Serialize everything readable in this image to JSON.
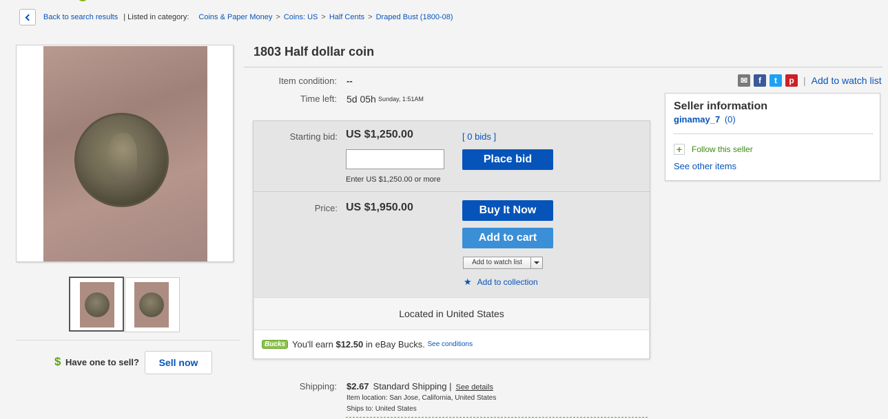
{
  "breadcrumb": {
    "back_label": "Back to search results",
    "listed_in": "| Listed in category:",
    "categories": [
      "Coins & Paper Money",
      "Coins: US",
      "Half Cents",
      "Draped Bust (1800-08)"
    ],
    "separator": ">"
  },
  "listing": {
    "title": "1803 Half dollar coin",
    "condition_label": "Item condition:",
    "condition_value": "--",
    "time_left_label": "Time left:",
    "time_left_value": "5d 05h",
    "time_left_day": "Sunday, 1:51AM"
  },
  "share": {
    "icons": [
      "email-icon",
      "facebook-icon",
      "twitter-icon",
      "pinterest-icon"
    ],
    "separator": "|",
    "watch_label": "Add to watch list"
  },
  "bid": {
    "starting_label": "Starting bid:",
    "starting_value": "US $1,250.00",
    "bids_link": "[ 0 bids ]",
    "input_value": "",
    "place_bid_label": "Place bid",
    "hint": "Enter US $1,250.00 or more"
  },
  "buy": {
    "price_label": "Price:",
    "price_value": "US $1,950.00",
    "buy_now_label": "Buy It Now",
    "add_cart_label": "Add to cart",
    "watch_dropdown_label": "Add to watch list",
    "collection_label": "Add to collection"
  },
  "location": {
    "text": "Located in United States"
  },
  "bucks": {
    "badge": "Bucks",
    "earn_prefix": "You'll earn",
    "earn_amount": "$12.50",
    "earn_suffix": "in eBay Bucks.",
    "conditions_link": "See conditions"
  },
  "seller": {
    "heading": "Seller information",
    "name": "ginamay_7",
    "feedback": "(0)",
    "follow_label": "Follow this seller",
    "other_items_label": "See other items"
  },
  "sell": {
    "question": "Have one to sell?",
    "button_label": "Sell now"
  },
  "shipping": {
    "label": "Shipping:",
    "cost": "$2.67",
    "method": "Standard Shipping |",
    "details_link": "See details",
    "item_location": "Item location:  San Jose, California, United States",
    "ships_to": "Ships to:  United States"
  },
  "colors": {
    "link": "#0654ba",
    "primary_button": "#0654ba",
    "secondary_button": "#3a8fd6",
    "green": "#5ba319"
  }
}
